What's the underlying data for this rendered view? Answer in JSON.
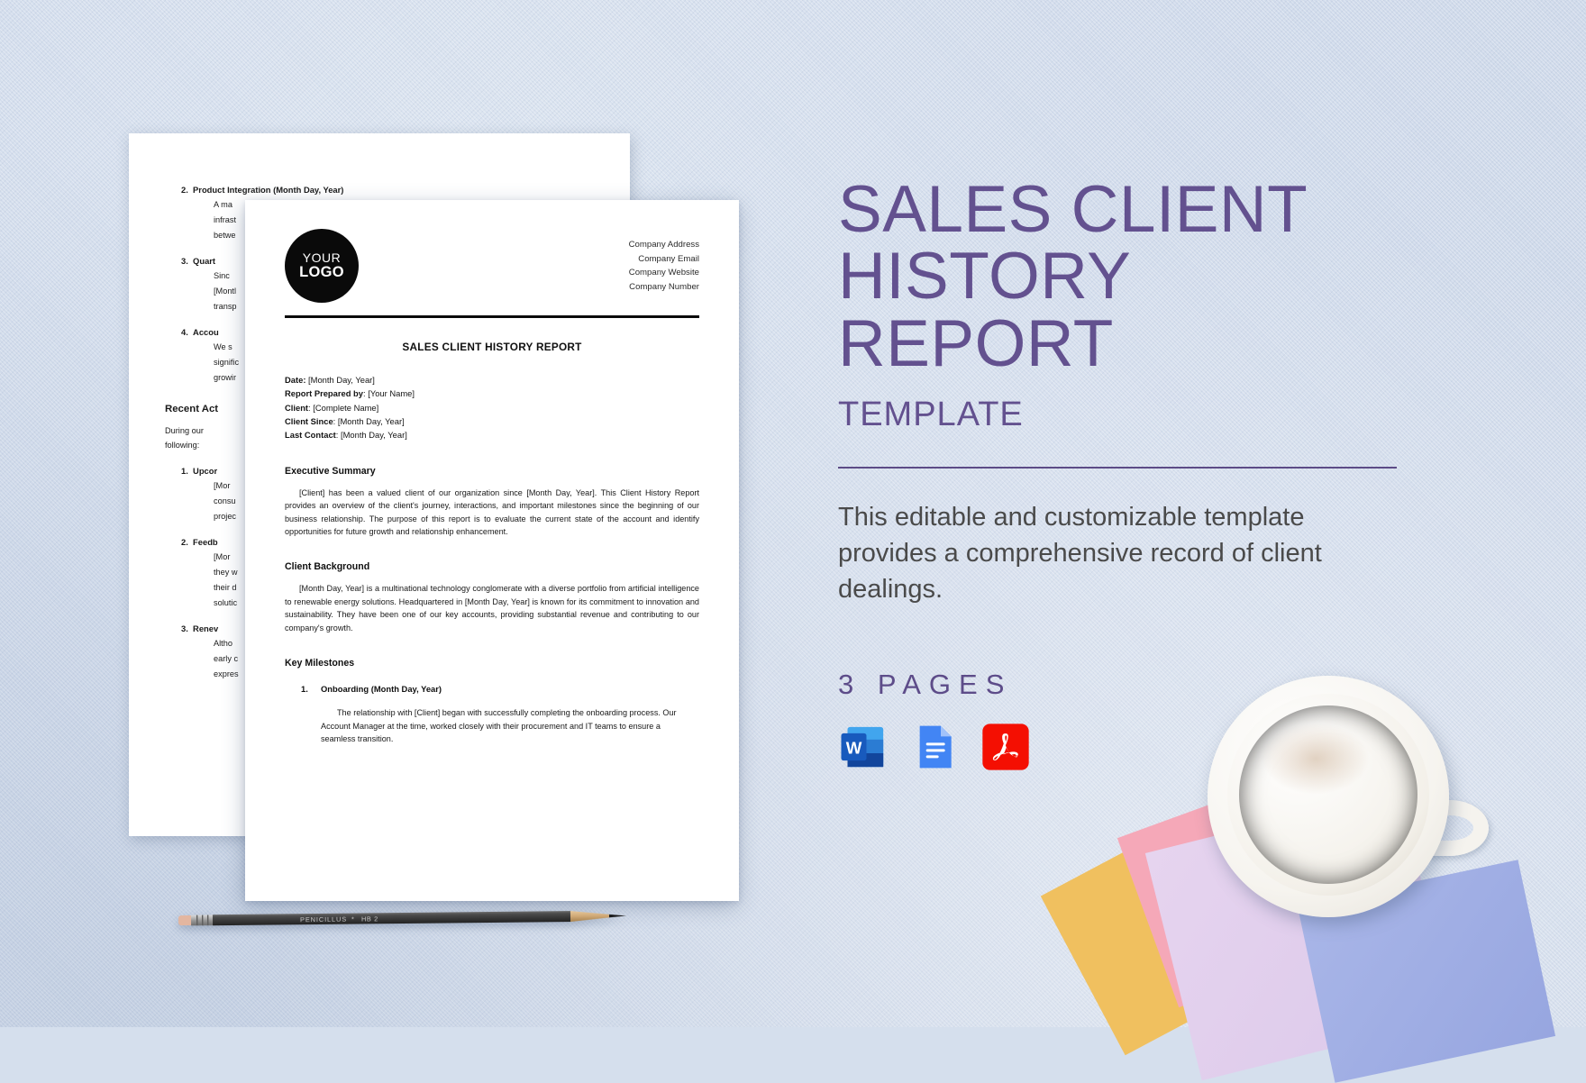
{
  "background": {
    "color": "#d5dfed"
  },
  "theme": {
    "accent_purple": "#63518f",
    "divider": "#5c4b86",
    "body_text": "#4a4a4a"
  },
  "panel": {
    "title_line1": "SALES CLIENT",
    "title_line2": "HISTORY",
    "title_line3": "REPORT",
    "subtitle": "TEMPLATE",
    "description": "This editable and customizable template provides a comprehensive record of client dealings.",
    "pages_label": "3 PAGES",
    "formats": [
      {
        "name": "word-icon",
        "letter": "W",
        "color": "#2b579a"
      },
      {
        "name": "google-docs-icon",
        "letter": "",
        "color": "#4285f4"
      },
      {
        "name": "pdf-icon",
        "letter": "A",
        "color": "#f40f02"
      }
    ]
  },
  "front_document": {
    "logo": {
      "line1": "YOUR",
      "line2": "LOGO"
    },
    "company": [
      "Company Address",
      "Company Email",
      "Company Website",
      "Company Number"
    ],
    "title": "SALES CLIENT HISTORY REPORT",
    "meta": [
      {
        "label": "Date:",
        "value": " [Month Day, Year]"
      },
      {
        "label": "Report Prepared by",
        "value": ": [Your Name]"
      },
      {
        "label": "Client",
        "value": ": [Complete Name]"
      },
      {
        "label": "Client Since",
        "value": ": [Month Day, Year]"
      },
      {
        "label": "Last Contact",
        "value": ": [Month Day, Year]"
      }
    ],
    "sections": [
      {
        "heading": "Executive Summary",
        "body": "[Client] has been a valued client of our organization since [Month Day, Year]. This Client History Report provides an overview of the client's journey, interactions, and important milestones since the beginning of our business relationship. The purpose of this report is to evaluate the current state of the account and identify opportunities for future growth and relationship enhancement."
      },
      {
        "heading": "Client Background",
        "body": "[Month Day, Year] is a multinational technology conglomerate with a diverse portfolio from artificial intelligence to renewable energy solutions. Headquartered in [Month Day, Year] is known for its commitment to innovation and sustainability. They have been one of our key accounts, providing substantial revenue and contributing to our company's growth."
      }
    ],
    "milestones_heading": "Key Milestones",
    "milestones": [
      {
        "number": "1.",
        "title": "Onboarding (Month Day, Year)",
        "body": "The relationship with [Client] began with successfully completing the onboarding process. Our Account Manager at the time, worked closely with their procurement and IT teams to ensure a seamless transition."
      }
    ]
  },
  "back_document": {
    "items": [
      {
        "number": "2.",
        "title": "Product Integration (Month Day, Year)",
        "lines": [
          "A ma",
          "infrast",
          "betwe"
        ]
      },
      {
        "number": "3.",
        "title": "Quart",
        "lines": [
          "Sinc",
          "[Montl",
          "transp"
        ]
      },
      {
        "number": "4.",
        "title": "Accou",
        "lines": [
          "We s",
          "signific",
          "growir"
        ]
      }
    ],
    "section_heading": "Recent Act",
    "section_lines": [
      "During our",
      "following:"
    ],
    "sub_items": [
      {
        "number": "1.",
        "title": "Upcor",
        "lines": [
          "[Mor",
          "consu",
          "projec"
        ]
      },
      {
        "number": "2.",
        "title": "Feedb",
        "lines": [
          "[Mor",
          "they w",
          "their d",
          "solutic"
        ]
      },
      {
        "number": "3.",
        "title": "Renev",
        "lines": [
          "Altho",
          "early c",
          "expres"
        ]
      }
    ]
  },
  "pencil": {
    "brand": "PENICILLUS",
    "grade": "HB 2",
    "separator": "*"
  }
}
